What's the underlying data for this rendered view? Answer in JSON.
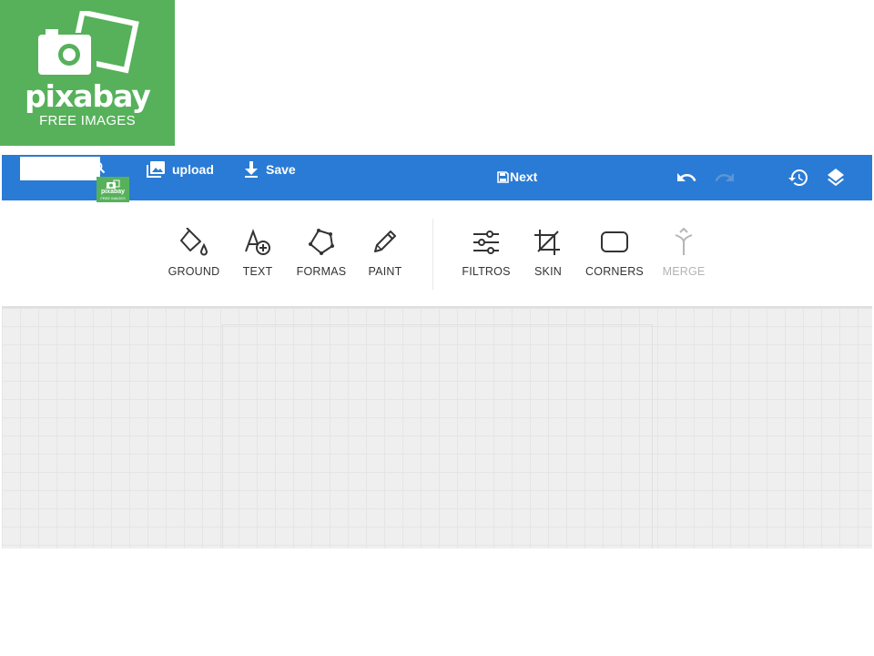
{
  "logo": {
    "word": "pixabay",
    "sub": "FREE IMAGES",
    "mini_word": "pixabay",
    "mini_sub": "FREE IMAGES",
    "color": "#56b15a"
  },
  "topbar": {
    "color": "#2a7bd5",
    "search": {
      "value": "",
      "placeholder": "",
      "icon": "search-icon"
    },
    "upload_label": "upload",
    "save_label": "Save",
    "next_label": "Next",
    "icons": [
      "upload-image-icon",
      "download-icon",
      "save-disk-icon",
      "undo-icon",
      "redo-icon",
      "history-icon",
      "layers-icon"
    ]
  },
  "tools": {
    "left": [
      {
        "label": "GROUND",
        "icon": "paint-bucket-icon"
      },
      {
        "label": "TEXT",
        "icon": "add-text-icon"
      },
      {
        "label": "FORMAS",
        "icon": "polygon-icon"
      },
      {
        "label": "PAINT",
        "icon": "pencil-icon"
      }
    ],
    "right": [
      {
        "label": "FILTROS",
        "icon": "sliders-icon"
      },
      {
        "label": "SKIN",
        "icon": "crop-icon"
      },
      {
        "label": "CORNERS",
        "icon": "rounded-rect-icon"
      },
      {
        "label": "MERGE",
        "icon": "merge-icon",
        "disabled": true
      }
    ]
  }
}
